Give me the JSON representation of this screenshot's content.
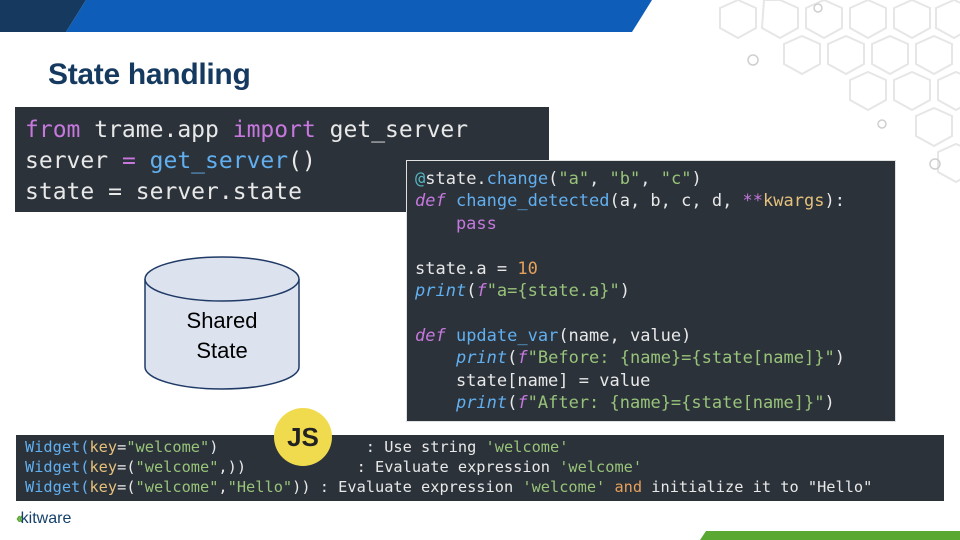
{
  "slide": {
    "title": "State handling",
    "brand_colors": {
      "navy": "#163a5f",
      "blue": "#0e5db8",
      "green": "#5aa832",
      "js_yellow": "#f0db4f",
      "code_bg": "#2b323a"
    }
  },
  "code_import": {
    "line1": {
      "from": "from",
      "module": " trame.app ",
      "import": "import",
      "name": " get_server"
    },
    "line2": {
      "var": "server",
      "eq": " = ",
      "call": "get_server",
      "parens": "()"
    },
    "line3": {
      "text": "state = server.state"
    }
  },
  "code_change": {
    "l1_at": "@",
    "l1_obj": "state.",
    "l1_fn": "change",
    "l1_open": "(",
    "l1_a": "\"a\"",
    "l1_c1": ", ",
    "l1_b": "\"b\"",
    "l1_c2": ", ",
    "l1_c": "\"c\"",
    "l1_close": ")",
    "l2_def": "def",
    "l2_name": " change_detected",
    "l2_args": "(a, b, c, d, ",
    "l2_star": "**",
    "l2_kw": "kwargs",
    "l2_end": "):",
    "l3": "    pass",
    "l5_a": "state.a = ",
    "l5_num": "10",
    "l6_print": "print",
    "l6_open": "(",
    "l6_f": "f",
    "l6_str": "\"a={state.a}\"",
    "l6_close": ")",
    "l8_def": "def",
    "l8_name": " update_var",
    "l8_args": "(name, value)",
    "l9_indent": "    ",
    "l9_print": "print",
    "l9_open": "(",
    "l9_f": "f",
    "l9_str": "\"Before: {name}={state[name]}\"",
    "l9_close": ")",
    "l10": "    state[name] = value",
    "l11_indent": "    ",
    "l11_print": "print",
    "l11_open": "(",
    "l11_f": "f",
    "l11_str": "\"After: {name}={state[name]}\"",
    "l11_close": ")"
  },
  "code_widget": {
    "r1": {
      "call": "Widget(",
      "key": "key",
      "eq": "=",
      "val": "\"welcome\"",
      "close": ")",
      "pad": "                ",
      "desc": ": Use string ",
      "q": "'welcome'"
    },
    "r2": {
      "call": "Widget(",
      "key": "key",
      "eq": "=(",
      "val": "\"welcome\"",
      "close": ",))",
      "pad": "            ",
      "desc": ": Evaluate expression ",
      "q": "'welcome'"
    },
    "r3": {
      "call": "Widget(",
      "key": "key",
      "eq": "=(",
      "val": "\"welcome\"",
      "comma": ",",
      "val2": "\"Hello\"",
      "close": ")) ",
      "desc": ": Evaluate expression ",
      "q": "'welcome'",
      "and": " and",
      "rest": " initialize it to \"Hello\""
    }
  },
  "diagram": {
    "line1": "Shared",
    "line2": "State"
  },
  "badge": {
    "label": "JS"
  },
  "logo": {
    "text": "kitware"
  }
}
